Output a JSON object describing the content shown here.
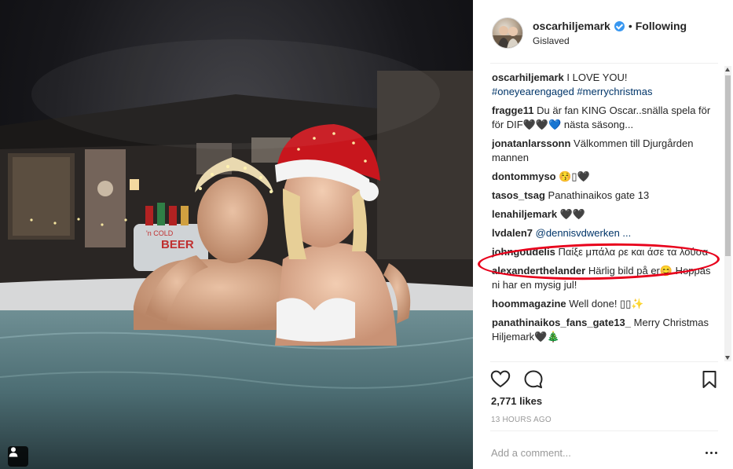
{
  "post": {
    "username": "oscarhiljemark",
    "follow_separator": "•",
    "follow_status": "Following",
    "location": "Gislaved"
  },
  "photo": {
    "cooler_text": "BEER",
    "cooler_small_text": "'n COLD"
  },
  "caption": {
    "user": "oscarhiljemark",
    "text": "I LOVE YOU!",
    "hashtags": "#oneyearengaged #merrychristmas"
  },
  "comments": [
    {
      "user": "fragge11",
      "text": "Du är fan KING Oscar..snälla spela för för DIF🖤🖤💙 nästa säsong..."
    },
    {
      "user": "jonatanlarssonn",
      "text": "Välkommen till Djurgården mannen"
    },
    {
      "user": "dontommyso",
      "text": "😚▯🖤"
    },
    {
      "user": "tasos_tsag",
      "text": "Panathinaikos gate 13"
    },
    {
      "user": "lenahiljemark",
      "text": "🖤🖤"
    },
    {
      "user": "lvdalen7",
      "text": "",
      "mention": "@dennisvdwerken ..."
    },
    {
      "user": "johngoudelis",
      "text": "Παίξε μπάλα ρε και άσε τα λούσα"
    },
    {
      "user": "alexanderthelander",
      "text": "Härlig bild på er😊 Hoppas ni har en mysig jul!"
    },
    {
      "user": "hoommagazine",
      "text": "Well done! ▯▯✨"
    },
    {
      "user": "panathinaikos_fans_gate13_",
      "text": "Merry Christmas Hiljemark🖤🎄"
    }
  ],
  "stats": {
    "likes": "2,771 likes",
    "time_ago": "13 HOURS AGO"
  },
  "composer": {
    "placeholder": "Add a comment..."
  },
  "icons": {
    "like": "heart-icon",
    "comment": "speech-bubble-icon",
    "save": "bookmark-icon",
    "tag": "user-tag-icon",
    "verified": "verified-badge-icon",
    "more": "more-options-icon"
  },
  "colors": {
    "link": "#003569",
    "verified": "#3897f0",
    "highlight_ring": "#e8001b",
    "muted": "#999999"
  }
}
